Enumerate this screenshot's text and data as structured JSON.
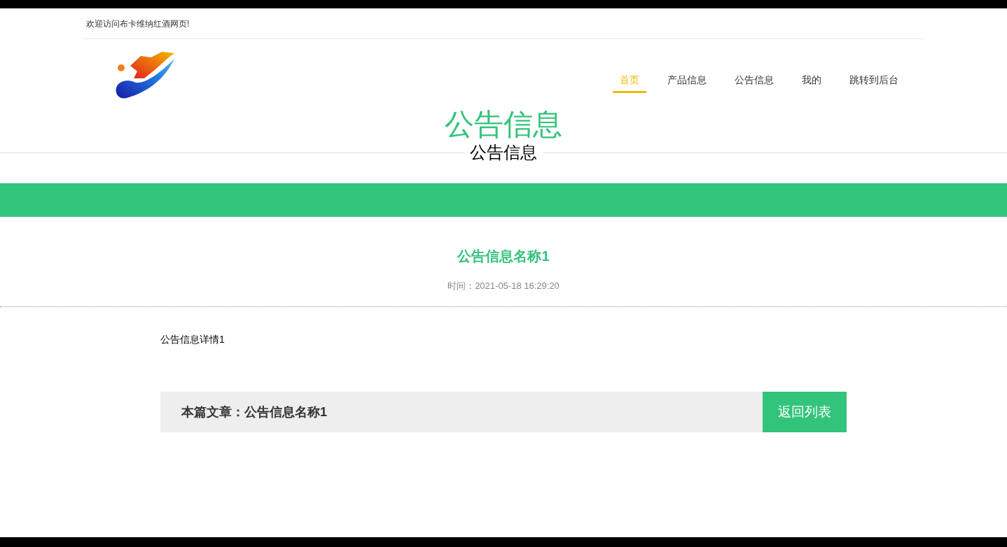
{
  "top_bar": {
    "welcome": "欢迎访问布卡维纳红酒网页!"
  },
  "nav": [
    {
      "label": "首页",
      "selected": true
    },
    {
      "label": "产品信息",
      "selected": false
    },
    {
      "label": "公告信息",
      "selected": false
    },
    {
      "label": "我的",
      "selected": false
    },
    {
      "label": "跳转到后台",
      "selected": false
    }
  ],
  "page_heading": {
    "title": "公告信息",
    "subtitle": "公告信息"
  },
  "article": {
    "title": "公告信息名称1",
    "time": "时间：2021-05-18 16:29:20",
    "body": "公告信息详情1"
  },
  "footer_bar": {
    "current": "本篇文章：公告信息名称1",
    "back_button": "返回列表"
  }
}
